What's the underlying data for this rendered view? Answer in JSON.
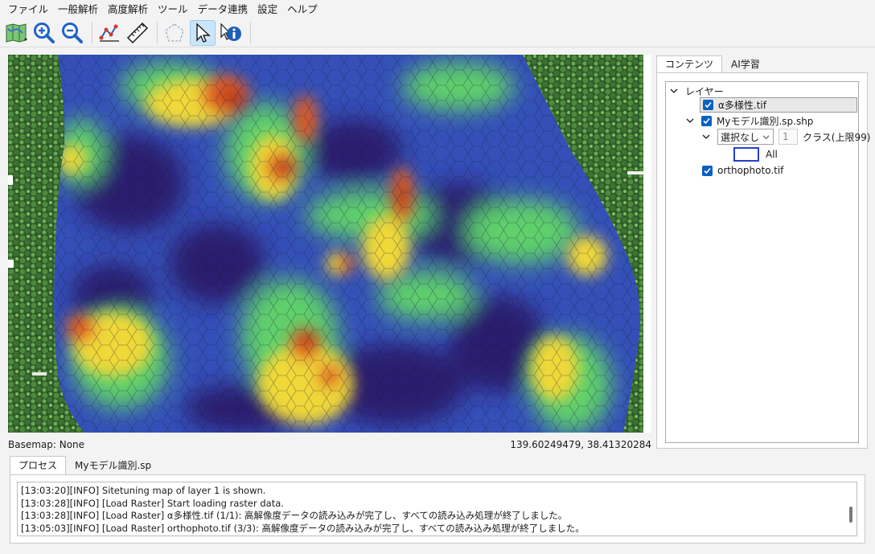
{
  "menu": [
    "ファイル",
    "一般解析",
    "高度解析",
    "ツール",
    "データ連携",
    "設定",
    "ヘルプ"
  ],
  "toolbar": {
    "buttons": [
      "map-layers-icon",
      "zoom-in-icon",
      "zoom-out-icon",
      "measure-line-icon",
      "ruler-icon",
      "polygon-icon",
      "pointer-icon",
      "info-icon"
    ],
    "active": "pointer-icon"
  },
  "map": {
    "basemap_label": "Basemap: None",
    "coordinates": "139.60249479, 38.41320284"
  },
  "right_panel": {
    "tabs": [
      "コンテンツ",
      "AI学習"
    ],
    "active_tab": "コンテンツ",
    "tree": {
      "root_label": "レイヤー",
      "layer1_name": "α多様性.tif",
      "layer2_name": "Myモデル識別.sp.shp",
      "class_select_value": "選択なし",
      "class_count_value": "1",
      "class_limit_label": "クラス(上限99)",
      "all_label": "All",
      "layer3_name": "orthophoto.tif"
    }
  },
  "bottom_panel": {
    "tabs": [
      "プロセス",
      "Myモデル識別.sp"
    ],
    "active_tab": "プロセス",
    "log_lines": [
      "[13:03:20][INFO] Sitetuning map of layer 1 is shown.",
      "[13:03:28][INFO] [Load Raster] Start loading raster data.",
      "[13:03:28][INFO] [Load Raster] α多様性.tif (1/1): 高解像度データの読み込みが完了し、すべての読み込み処理が終了しました。",
      "[13:05:03][INFO] [Load Raster] orthophoto.tif (3/3): 高解像度データの読み込みが完了し、すべての読み込み処理が終了しました。"
    ]
  },
  "colors": {
    "heat_low": "#2a1c6e",
    "heat_mid": "#2f7fd6",
    "heat_green": "#5fd06a",
    "heat_yellow": "#f0d838",
    "heat_high": "#b23a1c",
    "forest": "#2f5a2a",
    "accent": "#0a5fc4"
  }
}
